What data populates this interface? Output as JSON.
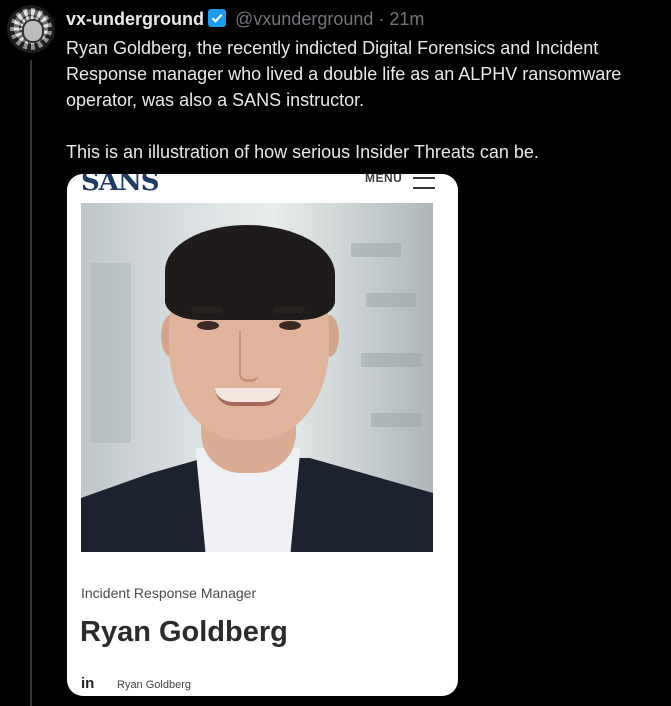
{
  "post": {
    "display_name": "vx-underground",
    "handle": "@vxunderground",
    "separator": "·",
    "timestamp": "21m",
    "paragraph1": "Ryan Goldberg, the recently indicted Digital Forensics and Incident Response manager who lived a double life as an ALPHV ransomware operator, was also a SANS instructor.",
    "paragraph2": "This is an illustration of how serious Insider Threats can be.",
    "verified_badge_color": "#1d9bf0"
  },
  "card": {
    "logo_text": "SANS",
    "menu_label": "MENU",
    "role": "Incident Response Manager",
    "name": "Ryan Goldberg",
    "linkedin_icon": "in",
    "linkedin_name": "Ryan Goldberg"
  },
  "colors": {
    "background": "#000000",
    "text": "#e7e9ea",
    "muted": "#71767b"
  }
}
